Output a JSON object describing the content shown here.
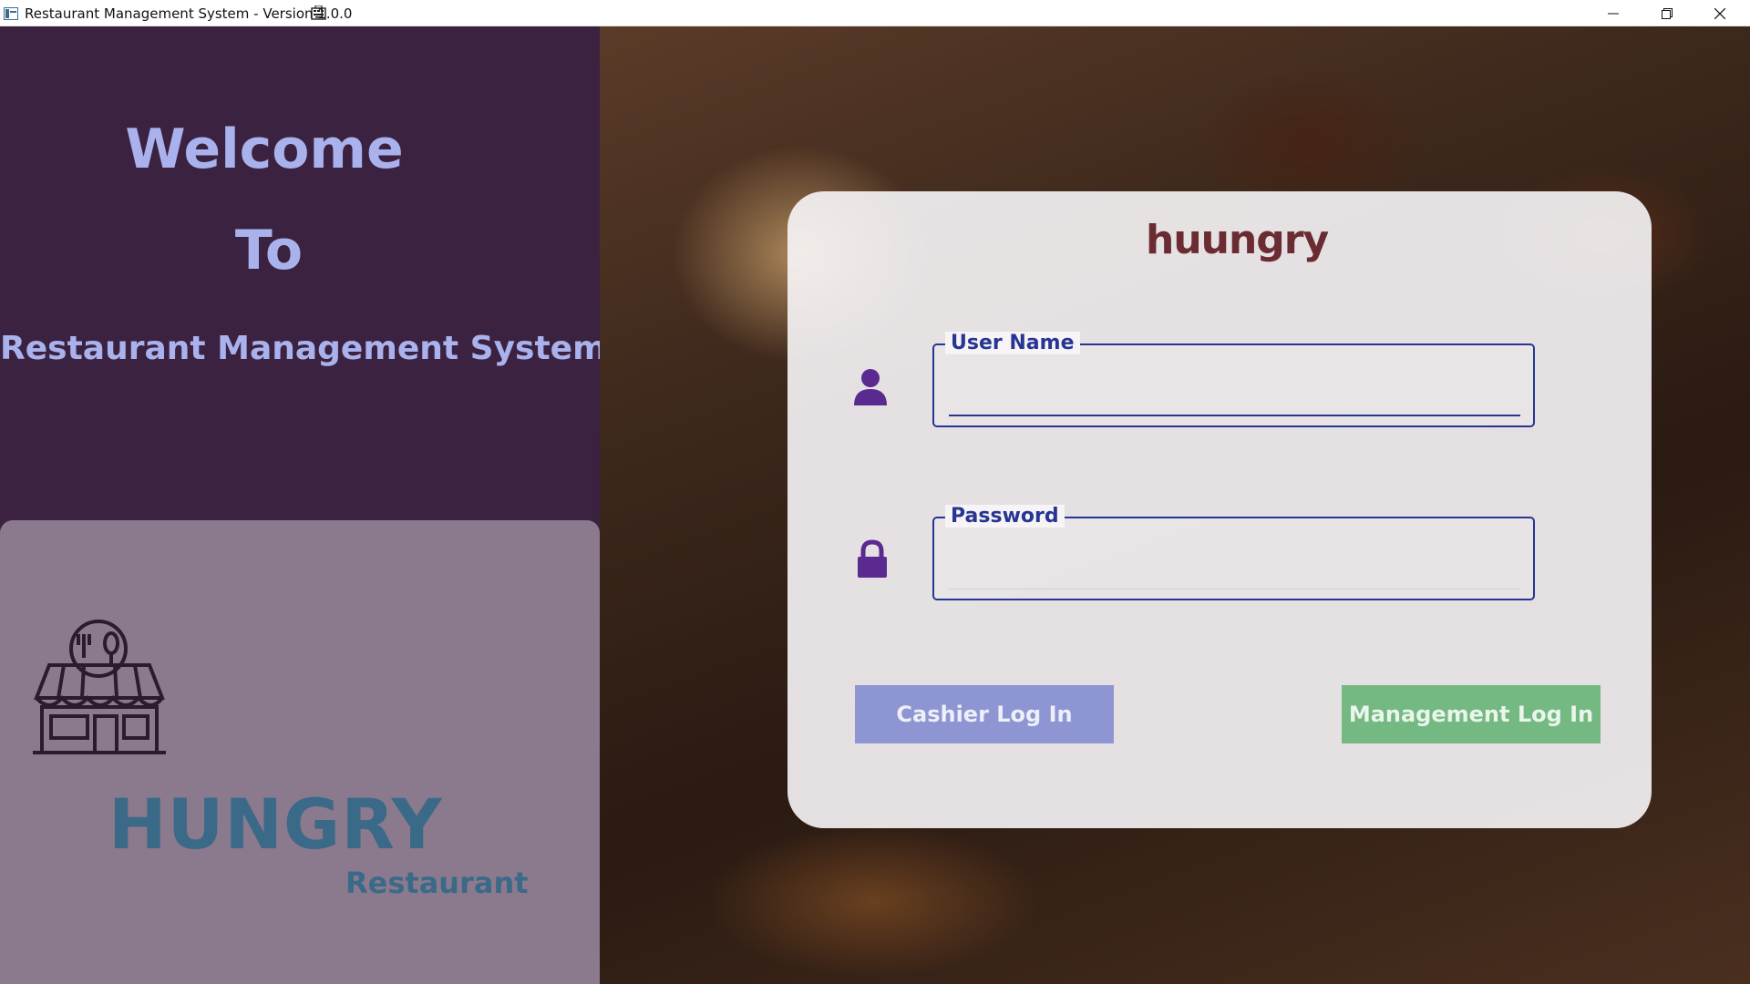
{
  "window": {
    "title": "Restaurant Management System - Version 1.0.0",
    "icons": [
      "app-icon",
      "keyboard-icon"
    ],
    "controls": [
      "minimize-icon",
      "restore-icon",
      "close-icon"
    ]
  },
  "left_panel": {
    "welcome_line1": "Welcome",
    "welcome_line2": "To",
    "welcome_line3": "Restaurant Management System",
    "brand_name": "HUNGRY",
    "brand_sub": "Restaurant",
    "colors": {
      "panel": "#3b2240",
      "card": "#8b7a8d",
      "heading": "#a9b2ec",
      "brand": "#3b6a88"
    }
  },
  "login": {
    "logo_text": "huungry",
    "username_label": "User Name",
    "username_value": "",
    "password_label": "Password",
    "password_value": "",
    "cashier_button": "Cashier Log In",
    "management_button": "Management Log In",
    "colors": {
      "accent": "#283593",
      "icon": "#5b2a91",
      "cashier": "#5463c9",
      "management": "#60b270"
    }
  }
}
